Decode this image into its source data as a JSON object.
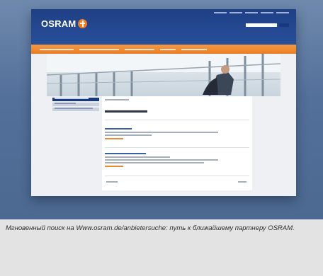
{
  "brand": {
    "name": "OSRAM",
    "orange": "#ef7e22",
    "blue": "#1e3f85"
  },
  "caption": "Мгновенный поиск на Www.osram.de/anbietersuche: путь к ближайшему партнеру OSRAM."
}
